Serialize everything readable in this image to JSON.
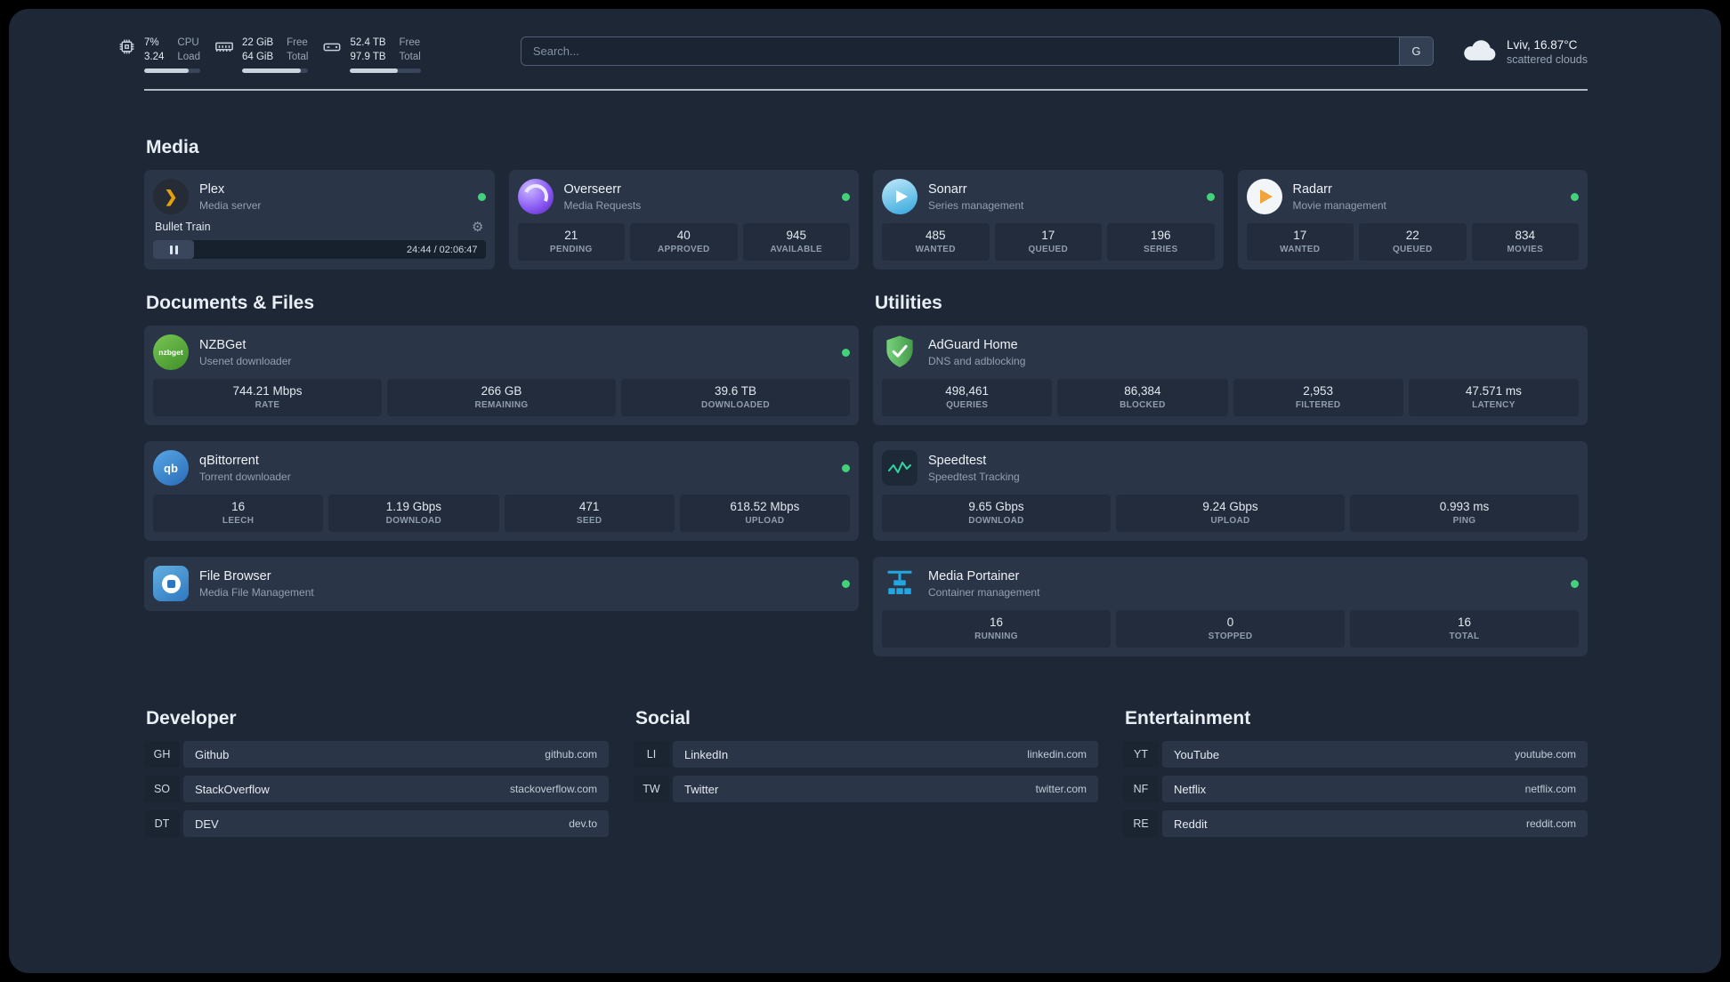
{
  "topbar": {
    "cpu": {
      "value": "7%",
      "secondary": "3.24",
      "label_top": "CPU",
      "label_bottom": "Load"
    },
    "memory": {
      "value": "22 GiB",
      "secondary": "64 GiB",
      "label_top": "Free",
      "label_bottom": "Total"
    },
    "disk": {
      "value": "52.4 TB",
      "secondary": "97.9 TB",
      "label_top": "Free",
      "label_bottom": "Total"
    },
    "search": {
      "placeholder": "Search...",
      "button_label": "G"
    },
    "weather": {
      "location": "Lviv, 16.87°C",
      "condition": "scattered clouds"
    }
  },
  "sections": {
    "media": "Media",
    "documents": "Documents & Files",
    "utilities": "Utilities"
  },
  "apps": {
    "plex": {
      "name": "Plex",
      "subtitle": "Media server",
      "track": "Bullet Train",
      "time": "24:44 / 02:06:47"
    },
    "overseerr": {
      "name": "Overseerr",
      "subtitle": "Media Requests",
      "stats": [
        {
          "value": "21",
          "label": "PENDING"
        },
        {
          "value": "40",
          "label": "APPROVED"
        },
        {
          "value": "945",
          "label": "AVAILABLE"
        }
      ]
    },
    "sonarr": {
      "name": "Sonarr",
      "subtitle": "Series management",
      "stats": [
        {
          "value": "485",
          "label": "WANTED"
        },
        {
          "value": "17",
          "label": "QUEUED"
        },
        {
          "value": "196",
          "label": "SERIES"
        }
      ]
    },
    "radarr": {
      "name": "Radarr",
      "subtitle": "Movie management",
      "stats": [
        {
          "value": "17",
          "label": "WANTED"
        },
        {
          "value": "22",
          "label": "QUEUED"
        },
        {
          "value": "834",
          "label": "MOVIES"
        }
      ]
    },
    "nzbget": {
      "name": "NZBGet",
      "subtitle": "Usenet downloader",
      "icon_text": "nzbget",
      "stats": [
        {
          "value": "744.21 Mbps",
          "label": "RATE"
        },
        {
          "value": "266 GB",
          "label": "REMAINING"
        },
        {
          "value": "39.6 TB",
          "label": "DOWNLOADED"
        }
      ]
    },
    "qbittorrent": {
      "name": "qBittorrent",
      "subtitle": "Torrent downloader",
      "icon_text": "qb",
      "stats": [
        {
          "value": "16",
          "label": "LEECH"
        },
        {
          "value": "1.19 Gbps",
          "label": "DOWNLOAD"
        },
        {
          "value": "471",
          "label": "SEED"
        },
        {
          "value": "618.52 Mbps",
          "label": "UPLOAD"
        }
      ]
    },
    "filebrowser": {
      "name": "File Browser",
      "subtitle": "Media File Management"
    },
    "adguard": {
      "name": "AdGuard Home",
      "subtitle": "DNS and adblocking",
      "stats": [
        {
          "value": "498,461",
          "label": "QUERIES"
        },
        {
          "value": "86,384",
          "label": "BLOCKED"
        },
        {
          "value": "2,953",
          "label": "FILTERED"
        },
        {
          "value": "47.571 ms",
          "label": "LATENCY"
        }
      ]
    },
    "speedtest": {
      "name": "Speedtest",
      "subtitle": "Speedtest Tracking",
      "stats": [
        {
          "value": "9.65 Gbps",
          "label": "DOWNLOAD"
        },
        {
          "value": "9.24 Gbps",
          "label": "UPLOAD"
        },
        {
          "value": "0.993 ms",
          "label": "PING"
        }
      ]
    },
    "portainer": {
      "name": "Media Portainer",
      "subtitle": "Container management",
      "stats": [
        {
          "value": "16",
          "label": "RUNNING"
        },
        {
          "value": "0",
          "label": "STOPPED"
        },
        {
          "value": "16",
          "label": "TOTAL"
        }
      ]
    }
  },
  "bookmarks": {
    "developer": {
      "title": "Developer",
      "items": [
        {
          "abbr": "GH",
          "name": "Github",
          "url": "github.com"
        },
        {
          "abbr": "SO",
          "name": "StackOverflow",
          "url": "stackoverflow.com"
        },
        {
          "abbr": "DT",
          "name": "DEV",
          "url": "dev.to"
        }
      ]
    },
    "social": {
      "title": "Social",
      "items": [
        {
          "abbr": "LI",
          "name": "LinkedIn",
          "url": "linkedin.com"
        },
        {
          "abbr": "TW",
          "name": "Twitter",
          "url": "twitter.com"
        }
      ]
    },
    "entertainment": {
      "title": "Entertainment",
      "items": [
        {
          "abbr": "YT",
          "name": "YouTube",
          "url": "youtube.com"
        },
        {
          "abbr": "NF",
          "name": "Netflix",
          "url": "netflix.com"
        },
        {
          "abbr": "RE",
          "name": "Reddit",
          "url": "reddit.com"
        }
      ]
    }
  },
  "colors": {
    "status_online": "#43d17a",
    "plex_accent": "#e5a00d",
    "background": "#1d2736",
    "card": "#2a3547"
  }
}
